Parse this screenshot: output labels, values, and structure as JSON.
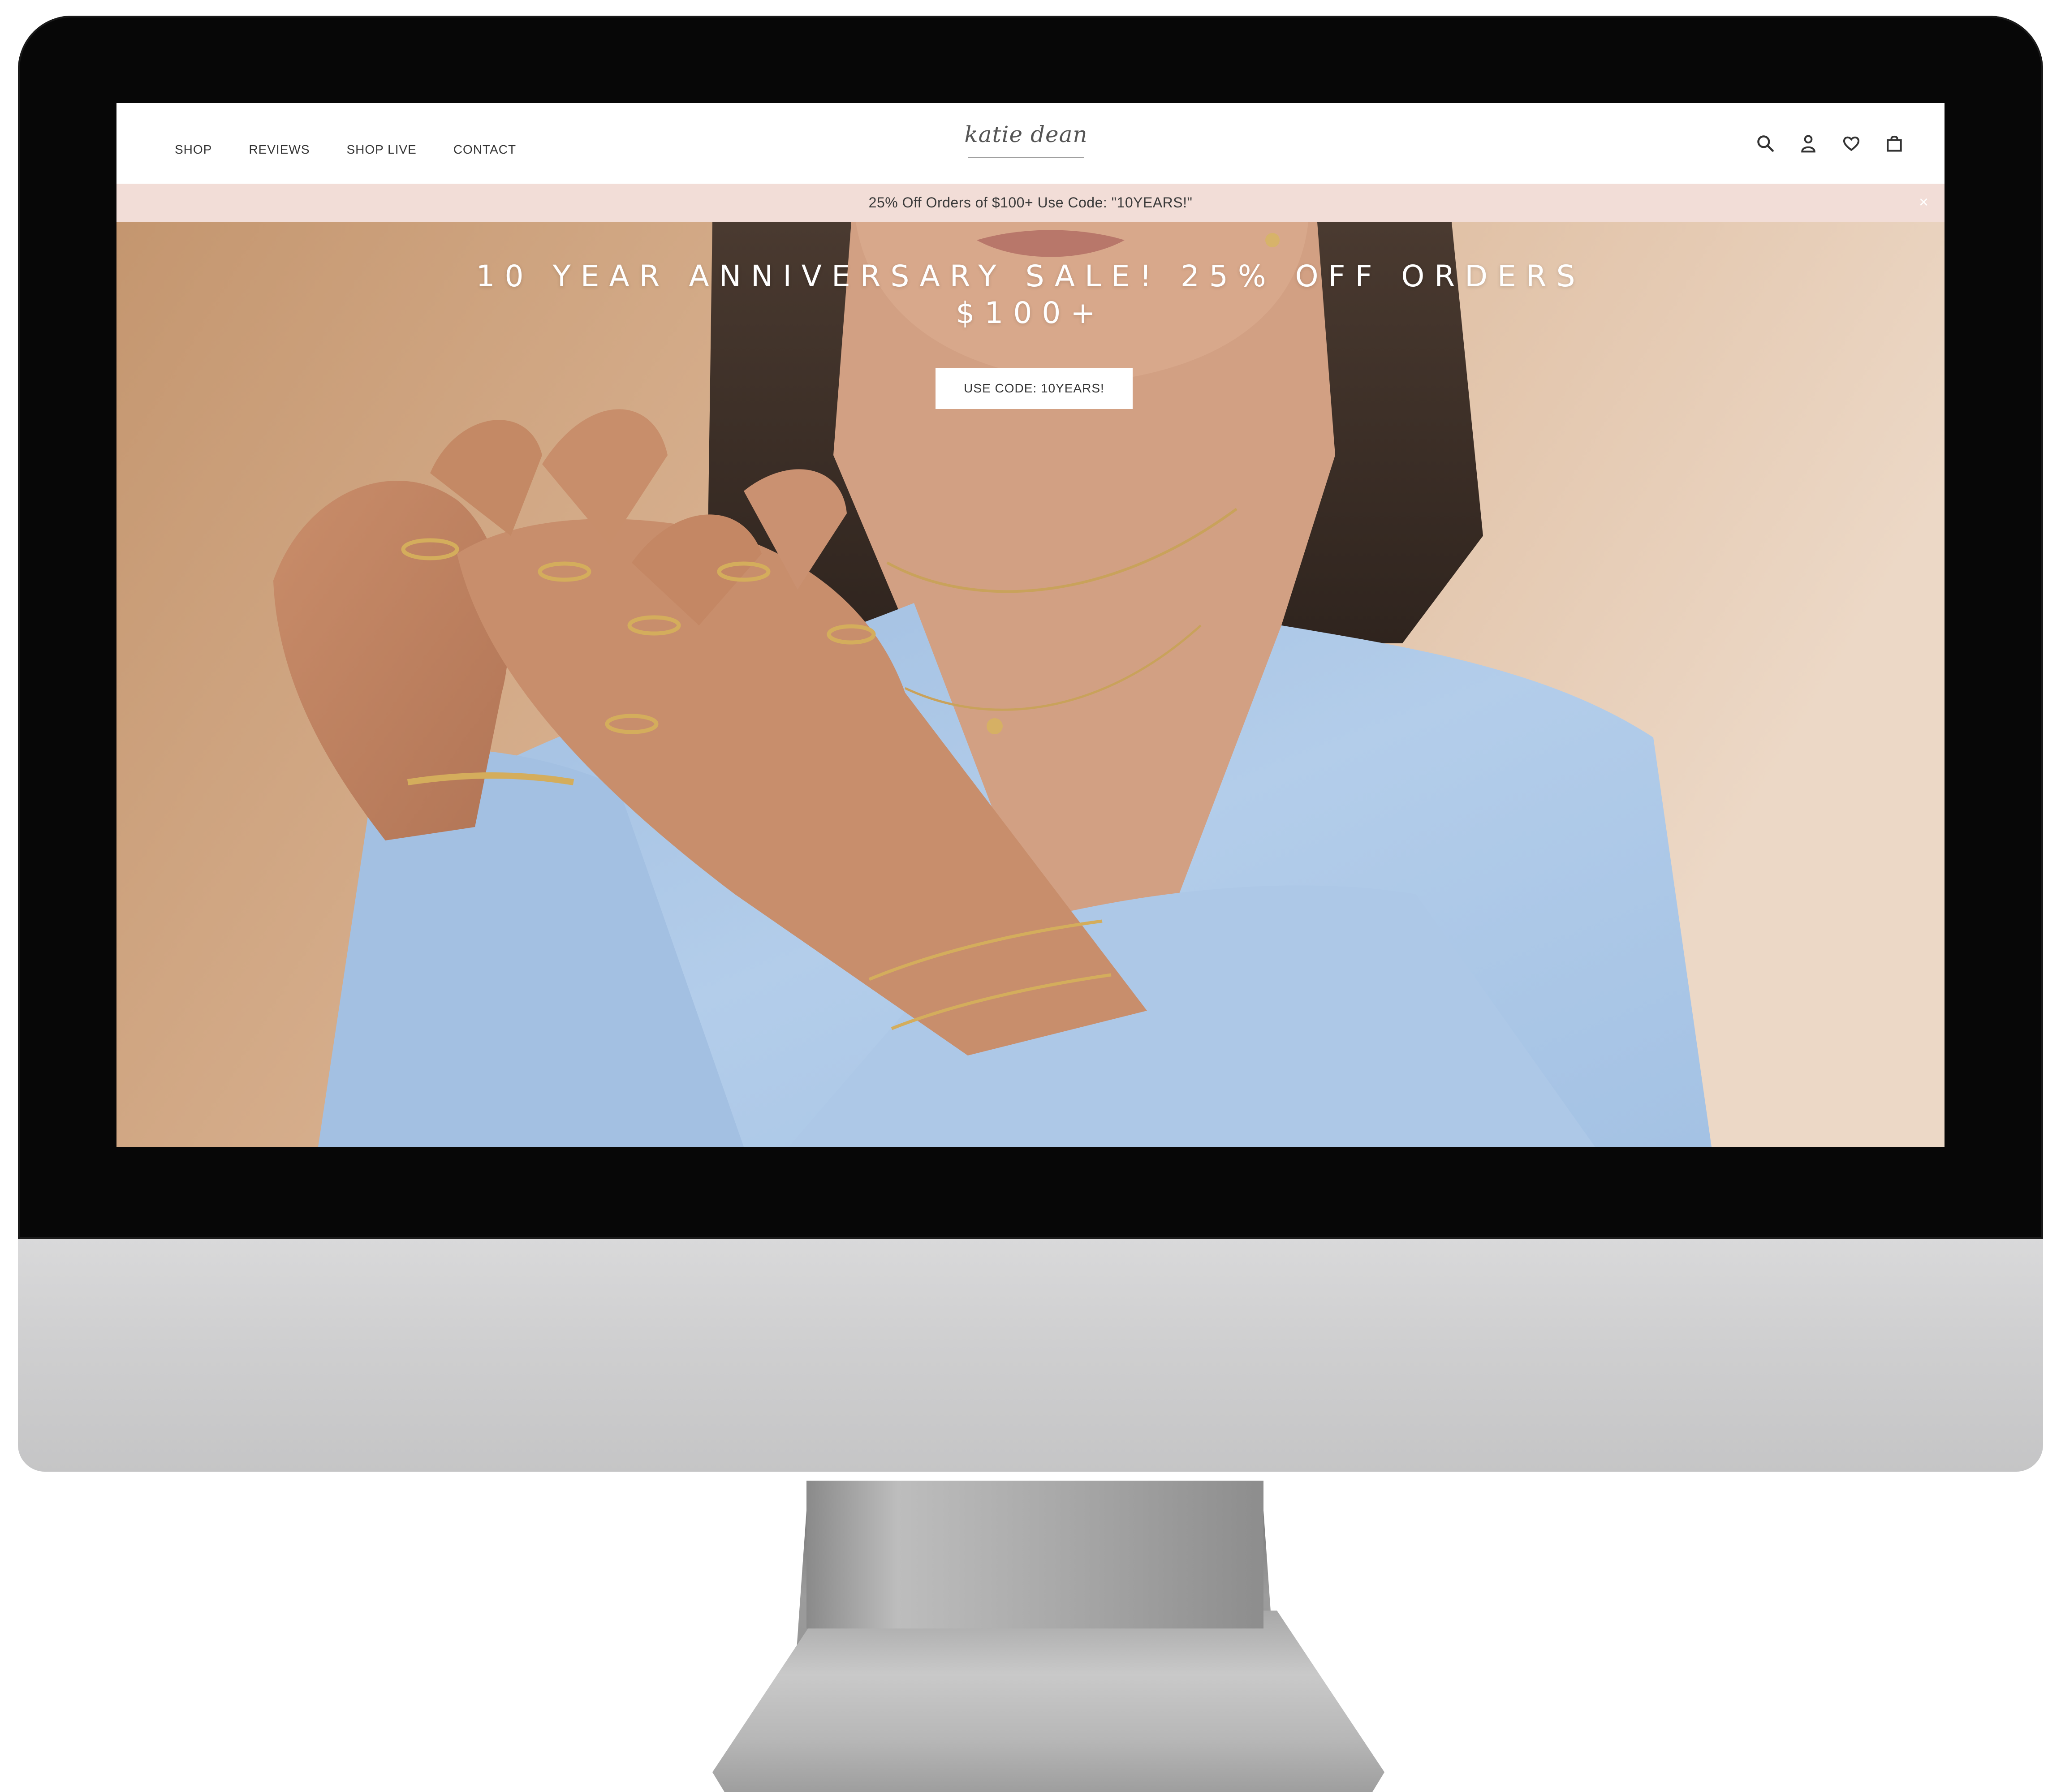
{
  "nav": {
    "items": [
      {
        "label": "SHOP"
      },
      {
        "label": "REVIEWS"
      },
      {
        "label": "SHOP LIVE"
      },
      {
        "label": "CONTACT"
      }
    ]
  },
  "logo": {
    "script": "katie dean"
  },
  "header_icons": [
    "search-icon",
    "account-icon",
    "wishlist-heart-icon",
    "cart-bag-icon"
  ],
  "promo_bar": {
    "text": "25% Off Orders of $100+ Use Code: \"10YEARS!\"",
    "close_symbol": "×"
  },
  "hero": {
    "title": "10 YEAR ANNIVERSARY SALE! 25% OFF ORDERS $100+",
    "button_label": "USE CODE: 10YEARS!"
  },
  "colors": {
    "promo_background": "#f2ddd7",
    "hero_background": "#d7ae8a",
    "sweater_blue": "#a9c6e6",
    "monitor_bezel": "#070707",
    "monitor_chin": "#cfcfd0"
  }
}
